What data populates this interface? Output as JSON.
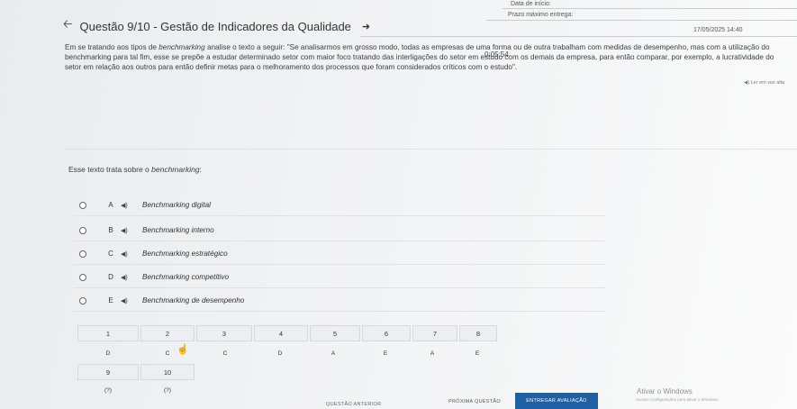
{
  "header": {
    "start_label": "Data de início:",
    "deadline_label": "Prazo máximo entrega:",
    "deadline_value": "17/05/2025 14:40",
    "title": "Questão 9/10 - Gestão de Indicadores da Qualidade",
    "timer": "0:05:54"
  },
  "question": {
    "text_part1": "Em se tratando aos tipos de ",
    "text_em": "benchmarking",
    "text_part2": " analise o texto a seguir: \"Se analisarmos em grosso modo, todas as empresas de uma forma ou de outra trabalham com medidas de desempenho, mas com a utilização do benchmarking para tal fim, esse se prepõe a estudar determinado setor com maior foco tratando das interligações do setor em estudo com os demais da empresa, para então comparar, por exemplo, a lucratividade do setor em relação aos outros para então definir metas para o melhoramento dos processos que foram considerados críticos com o estudo\".",
    "listen_label": "◀) Ler em voz alta",
    "prompt_part1": "Esse texto trata sobre o ",
    "prompt_em": "benchmarking",
    "prompt_part2": ":"
  },
  "options": [
    {
      "letter": "A",
      "text": "Benchmarking digital"
    },
    {
      "letter": "B",
      "text": "Benchmarking interno"
    },
    {
      "letter": "C",
      "text": "Benchmarking estratégico"
    },
    {
      "letter": "D",
      "text": "Benchmarking competitivo"
    },
    {
      "letter": "E",
      "text": "Benchmarking de desempenho"
    }
  ],
  "answer_grid": {
    "numbers": [
      "1",
      "2",
      "3",
      "4",
      "5",
      "6",
      "7",
      "8",
      "9",
      "10"
    ],
    "answers": [
      "D",
      "C",
      "C",
      "D",
      "A",
      "E",
      "A",
      "E",
      "(?)",
      "(?)"
    ]
  },
  "footer": {
    "prev_label": "QUESTÃO ANTERIOR",
    "next_label": "PRÓXIMA QUESTÃO",
    "submit_label": "ENTREGAR AVALIAÇÃO",
    "activate_title": "Ativar o Windows",
    "activate_sub": "Acesse Configurações para ativar o Windows."
  },
  "colors": {
    "submit_button": "#1f5fa3"
  }
}
